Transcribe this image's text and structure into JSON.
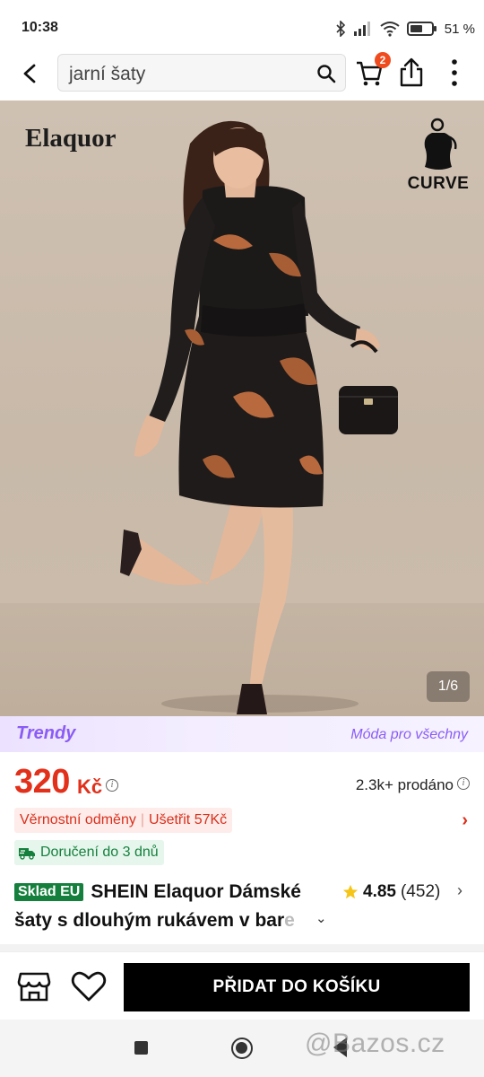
{
  "status_bar": {
    "time": "10:38",
    "battery": "51 %"
  },
  "search": {
    "query": "jarní šaty"
  },
  "header": {
    "cart_count": "2"
  },
  "image": {
    "brand_mark": "Elaquor",
    "curve_label": "CURVE",
    "counter": "1/6"
  },
  "banner": {
    "logo": "Trendy",
    "slogan": "Móda pro všechny"
  },
  "price": {
    "amount": "320",
    "currency": "Kč",
    "sold": "2.3k+ prodáno"
  },
  "loyalty": {
    "label": "Věrnostní odměny",
    "savings": "Ušetřit 57Kč"
  },
  "delivery": {
    "label": "Doručení do 3 dnů"
  },
  "product": {
    "stock_badge": "Sklad EU",
    "title_line1": "SHEIN Elaquor Dámské",
    "title_line2": "šaty s dlouhým rukávem v bar",
    "title_fade": "e",
    "rating": "4.85",
    "review_count": "(452)"
  },
  "actions": {
    "add_to_cart": "PŘIDAT DO KOŠÍKU"
  },
  "watermark": "@Bazos.cz",
  "colors": {
    "accent_price": "#e2301a",
    "trendy": "#8a5cf5",
    "delivery": "#15803d",
    "cart_badge": "#f04b1e"
  }
}
